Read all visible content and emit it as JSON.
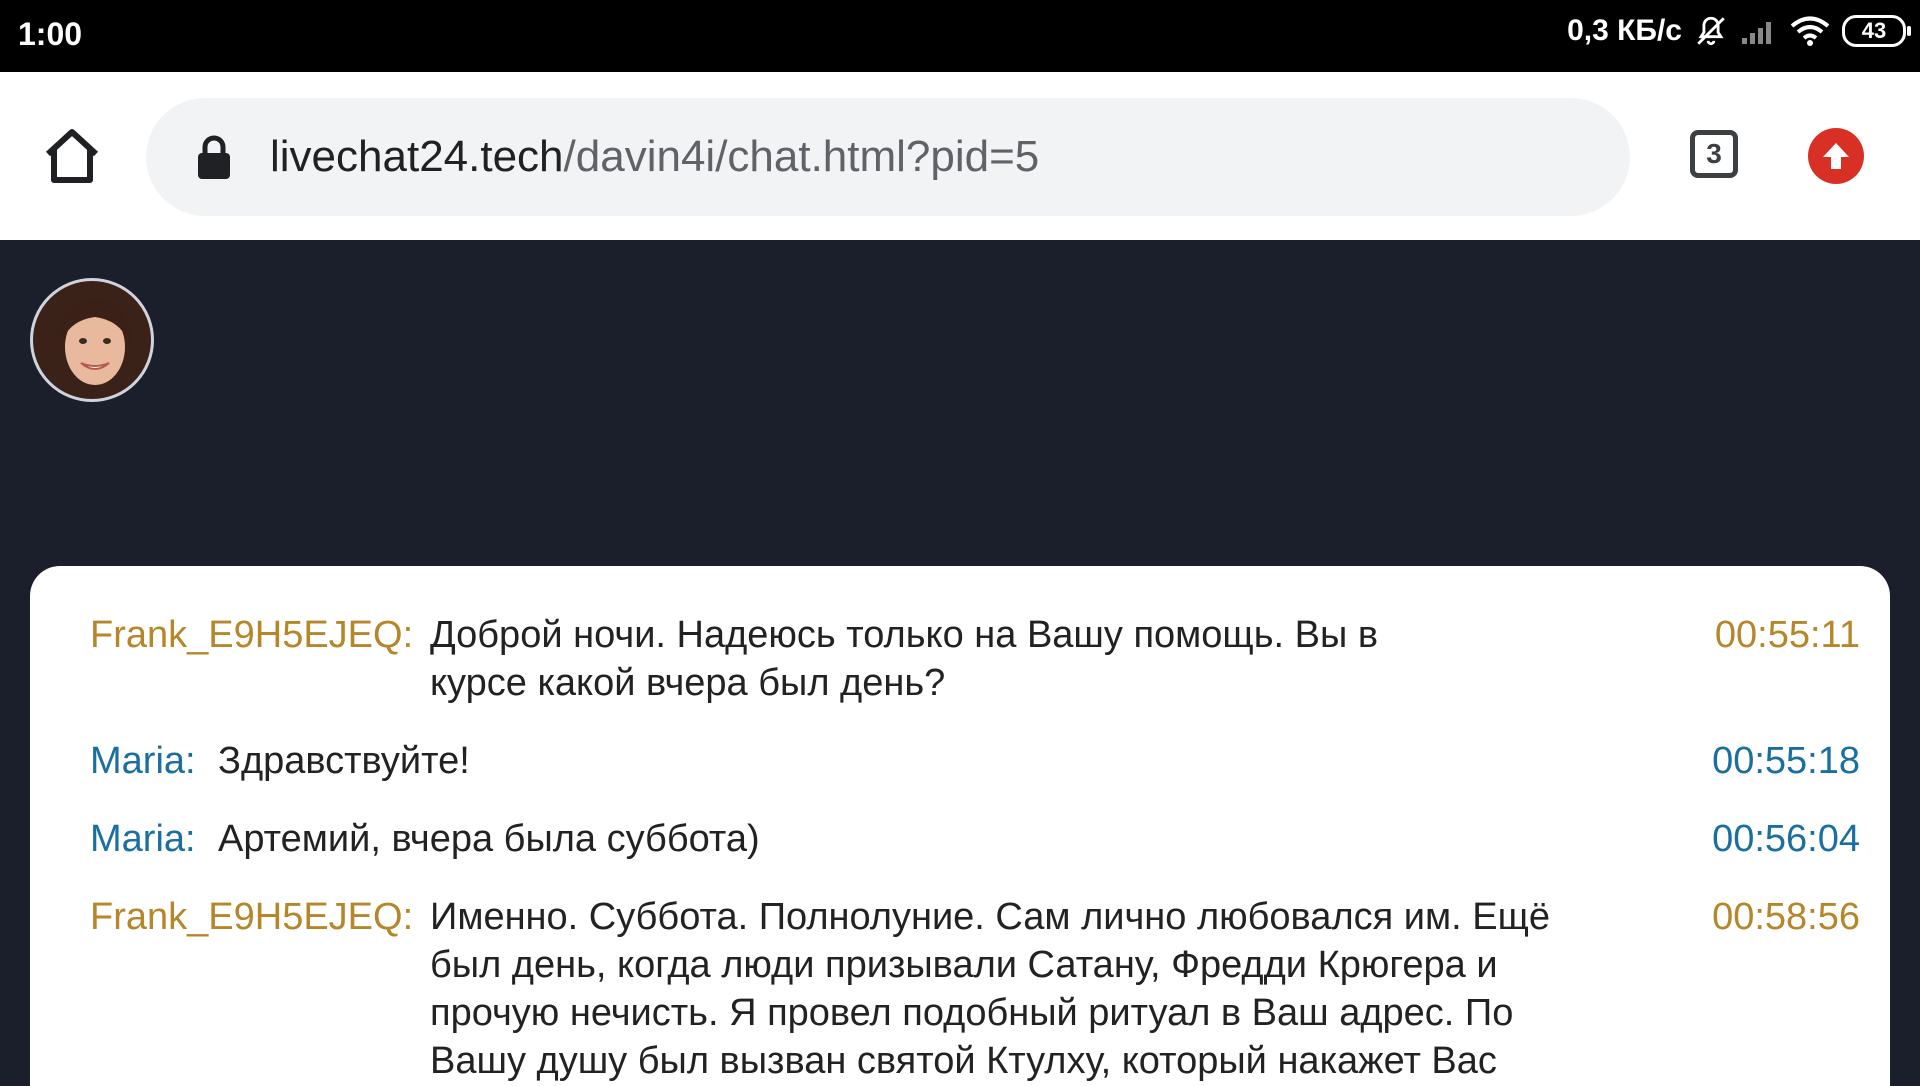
{
  "status_bar": {
    "time": "1:00",
    "speed": "0,3 КБ/с",
    "battery": "43"
  },
  "browser": {
    "url_domain": "livechat24.tech",
    "url_path": "/davin4i/chat.html?pid=5",
    "tab_count": "3"
  },
  "chat": {
    "messages": [
      {
        "sender": "Frank_E9H5EJEQ:",
        "text": "Доброй ночи. Надеюсь только на Вашу помощь. Вы в курсе какой вчера был день?",
        "time": "00:55:11",
        "color": "#b5862a"
      },
      {
        "sender": "Maria:",
        "text": "Здравствуйте!",
        "time": "00:55:18",
        "color": "#1b6fa0"
      },
      {
        "sender": "Maria:",
        "text": "Артемий, вчера была суббота)",
        "time": "00:56:04",
        "color": "#1b6fa0"
      },
      {
        "sender": "Frank_E9H5EJEQ:",
        "text": "Именно. Суббота. Полнолуние. Сам лично любовался им. Ещё был день, когда люди призывали Сатану, Фредди Крюгера и прочую нечисть. Я провел подобный ритуал в Ваш адрес. По Вашу душу был вызван святой Ктулху, который накажет Вас",
        "time": "00:58:56",
        "color": "#b5862a"
      }
    ]
  },
  "colors": {
    "page_bg": "#1b1f2b",
    "frank": "#b5862a",
    "maria": "#1b6fa0",
    "update_button": "#d93025"
  }
}
